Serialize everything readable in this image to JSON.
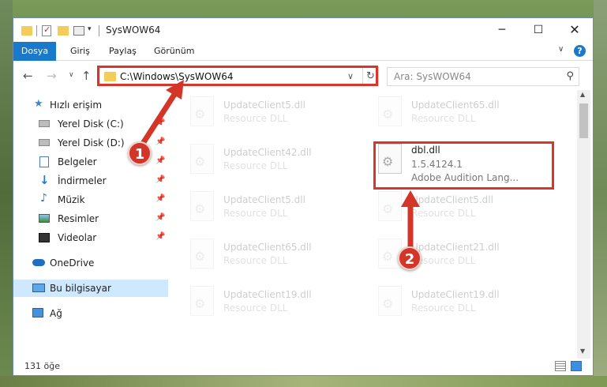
{
  "window": {
    "title": "SysWOW64"
  },
  "ribbon": {
    "tabs": [
      "Dosya",
      "Giriş",
      "Paylaş",
      "Görünüm"
    ]
  },
  "address": {
    "path": "C:\\Windows\\SysWOW64"
  },
  "search": {
    "placeholder": "Ara: SysWOW64"
  },
  "sidebar": {
    "items": [
      {
        "label": "Hızlı erişim",
        "icon": "star-icon"
      },
      {
        "label": "Yerel Disk (C:)",
        "icon": "drive-icon",
        "pinned": true
      },
      {
        "label": "Yerel Disk (D:)",
        "icon": "drive-icon",
        "pinned": true
      },
      {
        "label": "Belgeler",
        "icon": "documents-icon",
        "pinned": true
      },
      {
        "label": "İndirmeler",
        "icon": "download-icon",
        "pinned": true
      },
      {
        "label": "Müzik",
        "icon": "music-icon",
        "pinned": true
      },
      {
        "label": "Resimler",
        "icon": "pictures-icon",
        "pinned": true
      },
      {
        "label": "Videolar",
        "icon": "videos-icon",
        "pinned": true
      },
      {
        "label": "OneDrive",
        "icon": "cloud-icon"
      },
      {
        "label": "Bu bilgisayar",
        "icon": "computer-icon",
        "selected": true
      },
      {
        "label": "Ağ",
        "icon": "network-icon"
      }
    ]
  },
  "files": [
    {
      "name": "UpdateClient5.dll",
      "type": "Resource DLL",
      "faded": true
    },
    {
      "name": "UpdateClient65.dll",
      "type": "Resource DLL",
      "faded": true
    },
    {
      "name": "UpdateClient42.dll",
      "type": "Resource DLL",
      "faded": true
    },
    {
      "name": "dbl.dll",
      "version": "1.5.4124.1",
      "description": "Adobe Audition Lang...",
      "faded": false
    },
    {
      "name": "UpdateClient5.dll",
      "type": "Resource DLL",
      "faded": true
    },
    {
      "name": "UpdateClient5.dll",
      "type": "Resource DLL",
      "faded": true
    },
    {
      "name": "UpdateClient65.dll",
      "type": "Resource DLL",
      "faded": true
    },
    {
      "name": "UpdateClient21.dll",
      "type": "Resource DLL",
      "faded": true
    },
    {
      "name": "UpdateClient19.dll",
      "type": "Resource DLL",
      "faded": true
    },
    {
      "name": "UpdateClient19.dll",
      "type": "Resource DLL",
      "faded": true
    }
  ],
  "status": {
    "count": "131 öğe"
  },
  "annotations": {
    "marker1": "1",
    "marker2": "2",
    "color": "#d9362b"
  }
}
